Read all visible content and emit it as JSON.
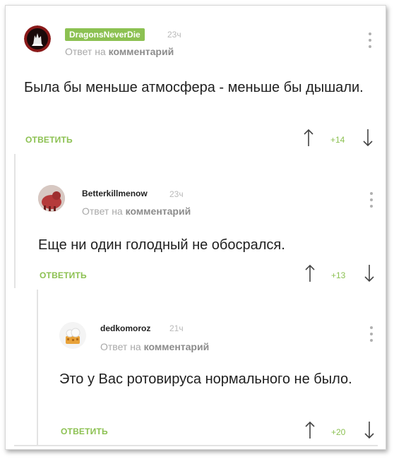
{
  "comments": [
    {
      "username": "DragonsNeverDie",
      "time": "23ч",
      "reply_prefix": "Ответ на",
      "reply_target": "комментарий",
      "text": "Была бы меньше атмосфера - меньше бы дышали.",
      "reply_label": "ОТВЕТИТЬ",
      "rating": "+14"
    },
    {
      "username": "Betterkillmenow",
      "time": "23ч",
      "reply_prefix": "Ответ на",
      "reply_target": "комментарий",
      "text": "Еще ни один голодный не обосрался.",
      "reply_label": "ОТВЕТИТЬ",
      "rating": "+13"
    },
    {
      "username": "dedkomoroz",
      "time": "21ч",
      "reply_prefix": "Ответ на",
      "reply_target": "комментарий",
      "text": "Это у Вас ротовируса нормального не было.",
      "reply_label": "ОТВЕТИТЬ",
      "rating": "+20"
    }
  ],
  "colors": {
    "accent_green": "#8cc152",
    "muted_gray": "#a8a8a8",
    "thread_line": "#e3e3e3"
  }
}
